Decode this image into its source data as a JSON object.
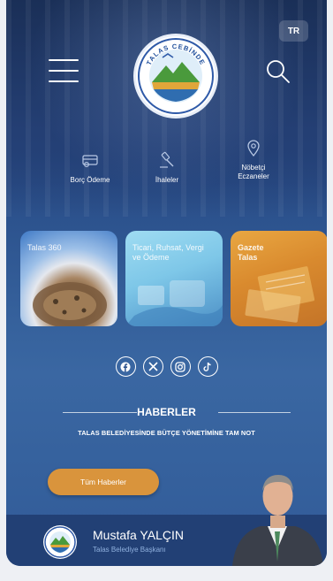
{
  "header": {
    "language": "TR",
    "logo_text": "TALAS CEBİNDE"
  },
  "quick_links": [
    {
      "label": "Borç Ödeme",
      "icon": "payment-icon"
    },
    {
      "label": "İhaleler",
      "icon": "auction-icon"
    },
    {
      "label": "Nöbetçi Eczaneler",
      "icon": "pharmacy-location-icon"
    }
  ],
  "cards": [
    {
      "label": "Talas 360"
    },
    {
      "label": "Ticari, Ruhsat, Vergi ve Ödeme"
    },
    {
      "label": "Gazete Talas"
    }
  ],
  "social": [
    "facebook-icon",
    "x-icon",
    "instagram-icon",
    "tiktok-icon"
  ],
  "news": {
    "section_title": "HABERLER",
    "headline": "TALAS BELEDİYESİNDE BÜTÇE YÖNETİMİNE TAM NOT",
    "all_news_label": "Tüm Haberler"
  },
  "mayor": {
    "name": "Mustafa YALÇIN",
    "role": "Talas Belediye Başkanı"
  },
  "colors": {
    "accent": "#d9943c",
    "background_top": "#1c3566",
    "background_mid": "#3a67a2"
  }
}
